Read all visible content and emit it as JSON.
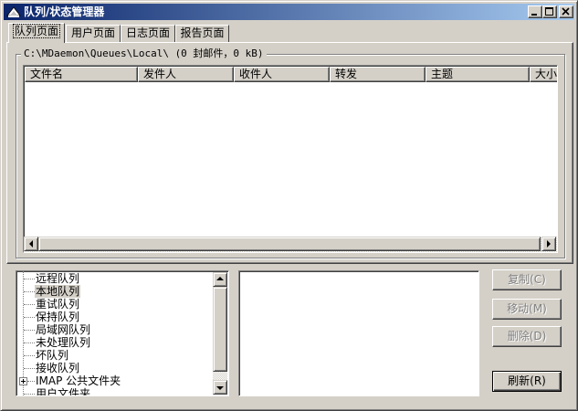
{
  "window": {
    "title": "队列/状态管理器",
    "titlebar_gradient": [
      "#0a246a",
      "#a6caf0"
    ]
  },
  "tabs": [
    {
      "label": "队列页面",
      "active": true
    },
    {
      "label": "用户页面",
      "active": false
    },
    {
      "label": "日志页面",
      "active": false
    },
    {
      "label": "报告页面",
      "active": false
    }
  ],
  "queue": {
    "path_label": "C:\\MDaemon\\Queues\\Local\\  (0 封邮件，0 kB)",
    "columns": [
      "文件名",
      "发件人",
      "收件人",
      "转发",
      "主题",
      "大小"
    ]
  },
  "tree": {
    "items": [
      "远程队列",
      "本地队列",
      "重试队列",
      "保持队列",
      "局域网队列",
      "未处理队列",
      "坏队列",
      "接收队列",
      "IMAP 公共文件夹",
      "用户文件夹"
    ],
    "selected": "本地队列"
  },
  "buttons": {
    "copy": "复制(C)",
    "move": "移动(M)",
    "delete": "删除(D)",
    "refresh": "刷新(R)"
  },
  "icons": {
    "app": "mdaemon-logo-icon",
    "minimize": "minimize-icon",
    "maximize": "maximize-icon",
    "close": "close-icon"
  }
}
